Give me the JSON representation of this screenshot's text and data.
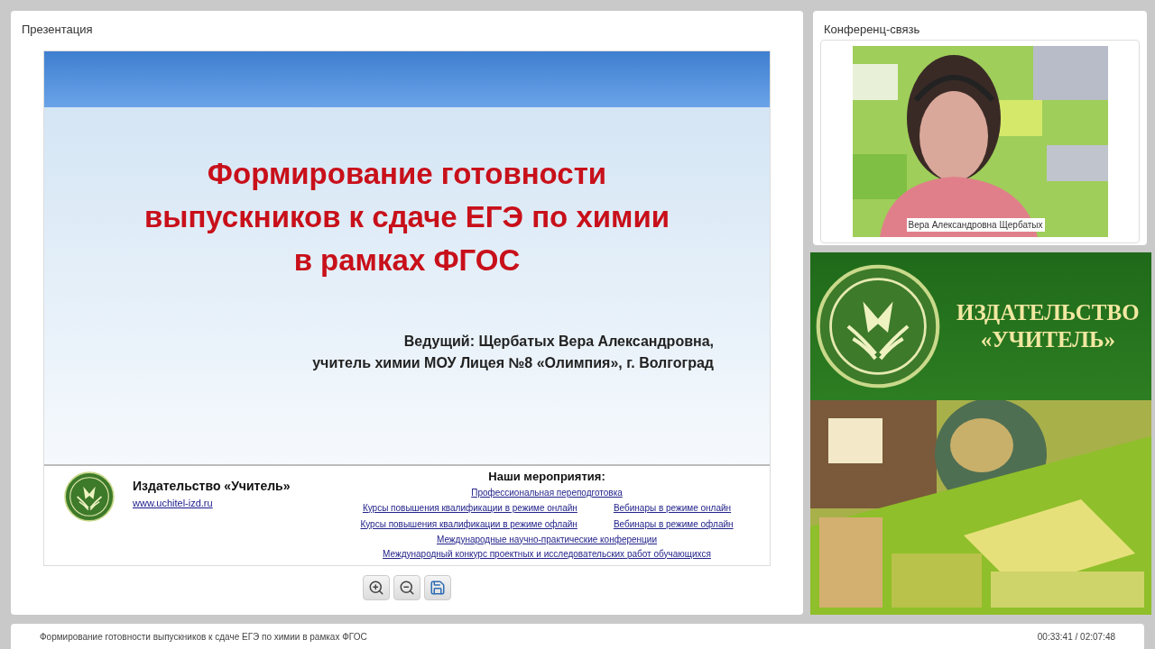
{
  "presentation_panel": {
    "title": "Презентация",
    "slide": {
      "title_lines": [
        "Формирование готовности",
        "выпускников к сдаче ЕГЭ по химии",
        "в рамках ФГОС"
      ],
      "presenter_lines": [
        "Ведущий:  Щербатых Вера Александровна,",
        "учитель химии МОУ Лицея №8 «Олимпия», г. Волгоград"
      ],
      "publisher": "Издательство «Учитель»",
      "website": "www.uchitel-izd.ru",
      "events_heading": "Наши мероприятия:",
      "event_rows": [
        [
          "Профессиональная переподготовка"
        ],
        [
          "Курсы повышения квалификации в режиме онлайн",
          "Вебинары в режиме онлайн"
        ],
        [
          "Курсы повышения квалификации в режиме офлайн",
          "Вебинары в режиме офлайн"
        ],
        [
          "Международные научно-практические конференции"
        ],
        [
          "Международный конкурс проектных и исследовательских работ обучающихся"
        ]
      ]
    },
    "tools": [
      {
        "kind": "zoom_in"
      },
      {
        "kind": "zoom_out"
      },
      {
        "kind": "save"
      }
    ]
  },
  "conference_panel": {
    "title": "Конференц-связь",
    "speaker_name": "Вера Александровна Щербатых"
  },
  "banner": {
    "lines": [
      "ИЗДАТЕЛЬСТВО",
      "«УЧИТЕЛЬ»"
    ],
    "photo": {
      "kind": "picture"
    }
  },
  "status_bar": {
    "title": "Формирование готовности выпускников к сдаче ЕГЭ по химии в рамках ФГОС",
    "time": "00:33:41 / 02:07:48"
  }
}
